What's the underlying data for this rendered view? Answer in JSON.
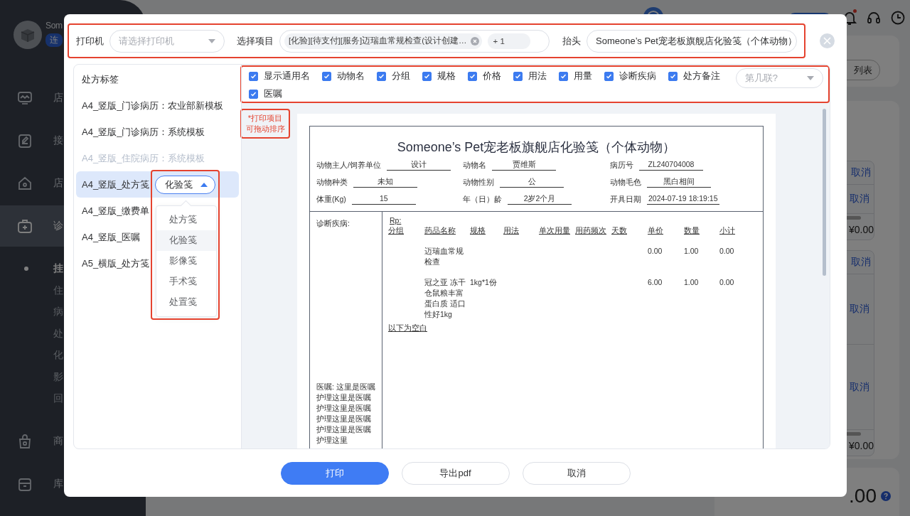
{
  "background": {
    "sidebar": {
      "brand": "Som",
      "status_badge": "连",
      "nav": [
        {
          "kind": "monitor",
          "label": "店",
          "selected": false
        },
        {
          "kind": "edit",
          "label": "接",
          "selected": false
        },
        {
          "kind": "home",
          "label": "店",
          "selected": false
        },
        {
          "kind": "medkit",
          "label": "诊",
          "selected": true,
          "children": [
            {
              "label": "挂",
              "selected": true
            },
            {
              "label": "住",
              "selected": false
            },
            {
              "label": "病",
              "selected": false
            },
            {
              "label": "处",
              "selected": false
            },
            {
              "label": "化",
              "selected": false
            },
            {
              "label": "影",
              "selected": false
            },
            {
              "label": "回",
              "selected": false
            }
          ]
        },
        {
          "kind": "bag",
          "label": "商",
          "selected": false
        },
        {
          "kind": "box",
          "label": "库",
          "selected": false
        }
      ]
    },
    "header": {
      "notification_dot": true
    },
    "visit_list_button": "列表",
    "cards": [
      {
        "action": "取消",
        "rows": [
          "取消"
        ],
        "total": "¥0.00"
      },
      {
        "action": "取消",
        "rows": [
          "取消",
          "取消"
        ],
        "total": "¥0.00"
      }
    ],
    "total_amount": ".00"
  },
  "dialog": {
    "printer": {
      "label": "打印机",
      "placeholder": "请选择打印机"
    },
    "items": {
      "label": "选择项目",
      "tags": [
        {
          "label": "[化验][待支付][服务]迈瑞血常规检查(设计创建…",
          "closable": true
        },
        {
          "label": "+ 1",
          "closable": false
        }
      ]
    },
    "heading": {
      "label": "抬头",
      "value": "Someone’s Pet宠老板旗舰店化验笺（个体动物）"
    },
    "templates": {
      "title": "处方标签",
      "items": [
        {
          "label": "A4_竖版_门诊病历：农业部新模板",
          "selected": false,
          "disabled": false
        },
        {
          "label": "A4_竖版_门诊病历：系统模板",
          "selected": false,
          "disabled": false
        },
        {
          "label": "A4_竖版_住院病历：系统模板",
          "selected": false,
          "disabled": true
        },
        {
          "label": "A4_竖版_处方笺",
          "selected": true,
          "disabled": false,
          "type_select": {
            "value": "化验笺",
            "expanded": true,
            "options": [
              {
                "label": "处方笺",
                "selected": false
              },
              {
                "label": "化验笺",
                "selected": true
              },
              {
                "label": "影像笺",
                "selected": false
              },
              {
                "label": "手术笺",
                "selected": false
              },
              {
                "label": "处置笺",
                "selected": false
              }
            ]
          }
        },
        {
          "label": "A4_竖版_缴费单",
          "selected": false,
          "disabled": false
        },
        {
          "label": "A4_竖版_医嘱",
          "selected": false,
          "disabled": false
        },
        {
          "label": "A5_横版_处方笺",
          "selected": false,
          "disabled": false
        }
      ]
    },
    "options": {
      "checkboxes": [
        {
          "label": "显示通用名",
          "checked": true
        },
        {
          "label": "动物名",
          "checked": true
        },
        {
          "label": "分组",
          "checked": true
        },
        {
          "label": "规格",
          "checked": true
        },
        {
          "label": "价格",
          "checked": true
        },
        {
          "label": "用法",
          "checked": true
        },
        {
          "label": "用量",
          "checked": true
        },
        {
          "label": "诊断疾病",
          "checked": true
        },
        {
          "label": "处方备注",
          "checked": true
        },
        {
          "label": "医嘱",
          "checked": true
        }
      ],
      "copy_select": {
        "placeholder": "第几联?"
      }
    },
    "note": [
      "*打印项目",
      "可拖动排序"
    ],
    "preview": {
      "title": "Someone’s Pet宠老板旗舰店化验笺（个体动物）",
      "fields": [
        {
          "label": "动物主人/饲养单位",
          "value": "设计"
        },
        {
          "label": "动物名",
          "value": "贾维斯"
        },
        {
          "label": "病历号",
          "value": "ZL240704008"
        },
        {
          "label": "动物种类",
          "value": "未知"
        },
        {
          "label": "动物性别",
          "value": "公"
        },
        {
          "label": "动物毛色",
          "value": "黑白相间"
        },
        {
          "label": "体重(Kg)",
          "value": "15"
        },
        {
          "label": "年（日）龄",
          "value": "2岁2个月"
        },
        {
          "label": "开具日期",
          "value": "2024-07-19 18:19:15"
        }
      ],
      "diagnosis_label": "诊断疾病:",
      "advice": "医嘱: 这里是医嘱护理这里是医嘱护理这里是医嘱护理这里是医嘱护理这里是医嘱护理这里",
      "rp": "Rp:",
      "columns": [
        "分组",
        "药品名称",
        "规格",
        "用法",
        "单次用量",
        "用药频次",
        "天数",
        "单价",
        "数量",
        "小计"
      ],
      "rows": [
        {
          "name": "迈瑞血常规检查",
          "price": "0.00",
          "quantity": "1.00",
          "subtotal": "0.00"
        },
        {
          "name": "冠之亚 冻干仓鼠粮丰富蛋白质 适口性好1kg",
          "spec": "1kg*1份",
          "price": "6.00",
          "quantity": "1.00",
          "subtotal": "0.00"
        }
      ],
      "end_note": "以下为空白"
    },
    "buttons": [
      {
        "label": "打印",
        "kind": "primary"
      },
      {
        "label": "导出pdf",
        "kind": "default"
      },
      {
        "label": "取消",
        "kind": "default"
      }
    ]
  }
}
